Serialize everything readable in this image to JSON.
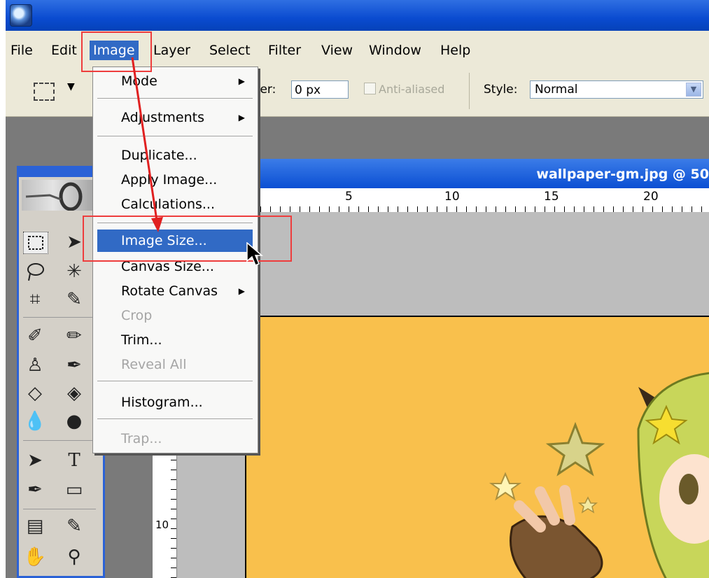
{
  "menubar": {
    "items": [
      "File",
      "Edit",
      "Image",
      "Layer",
      "Select",
      "Filter",
      "View",
      "Window",
      "Help"
    ],
    "active": "Image"
  },
  "options": {
    "feather_label": "ther:",
    "feather_value": "0 px",
    "anti_aliased_label": "Anti-aliased",
    "style_label": "Style:",
    "style_value": "Normal"
  },
  "document": {
    "title": "wallpaper-gm.jpg @ 50",
    "ruler_top_numbers": [
      "5",
      "10",
      "15",
      "20"
    ],
    "ruler_left_number": "10"
  },
  "image_menu": {
    "items": [
      {
        "label": "Mode",
        "submenu": true,
        "disabled": false
      },
      {
        "label": "Adjustments",
        "submenu": true,
        "disabled": false
      },
      {
        "label": "Duplicate...",
        "submenu": false,
        "disabled": false
      },
      {
        "label": "Apply Image...",
        "submenu": false,
        "disabled": false
      },
      {
        "label": "Calculations...",
        "submenu": false,
        "disabled": false
      },
      {
        "label": "Image Size...",
        "submenu": false,
        "disabled": false,
        "highlighted": true
      },
      {
        "label": "Canvas Size...",
        "submenu": false,
        "disabled": false
      },
      {
        "label": "Rotate Canvas",
        "submenu": true,
        "disabled": false
      },
      {
        "label": "Crop",
        "submenu": false,
        "disabled": true
      },
      {
        "label": "Trim...",
        "submenu": false,
        "disabled": false
      },
      {
        "label": "Reveal All",
        "submenu": false,
        "disabled": true
      },
      {
        "label": "Histogram...",
        "submenu": false,
        "disabled": false
      },
      {
        "label": "Trap...",
        "submenu": false,
        "disabled": true
      }
    ]
  },
  "toolbox": {
    "tools": [
      "rect-marquee",
      "move",
      "lasso",
      "magic-wand",
      "crop",
      "slice",
      "healing-brush",
      "brush",
      "clone-stamp",
      "history-brush",
      "eraser",
      "paint-bucket",
      "blur",
      "dodge",
      "path-select",
      "type",
      "pen",
      "shape",
      "notes",
      "eyedropper",
      "hand",
      "zoom"
    ]
  },
  "colors": {
    "titlebar": "#0a4bd0",
    "menu_highlight": "#316ac5",
    "annotation": "#ee3d3d",
    "canvas": "#f9c04c"
  }
}
